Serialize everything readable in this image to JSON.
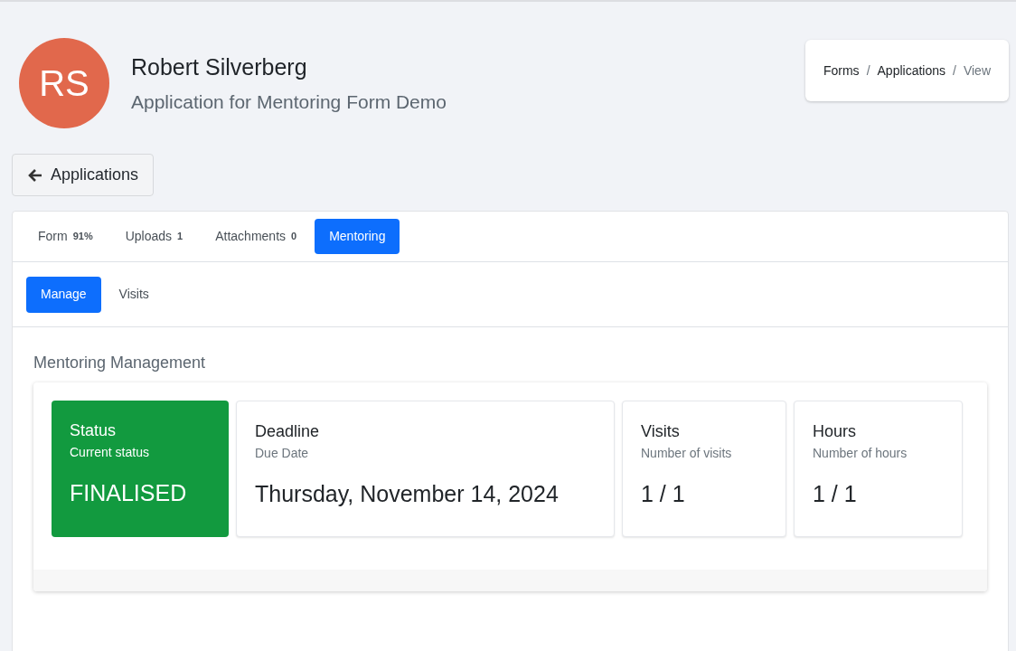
{
  "header": {
    "initials": "RS",
    "name": "Robert Silverberg",
    "subtitle": "Application for Mentoring Form Demo"
  },
  "breadcrumb": [
    {
      "label": "Forms",
      "current": false
    },
    {
      "separator_before": "/",
      "label": "Applications",
      "current": false
    },
    {
      "separator_before": "/",
      "label": "View",
      "current": true
    }
  ],
  "back_button": {
    "label": "Applications"
  },
  "tabs": [
    {
      "label": "Form",
      "badge": "91%",
      "selected": false
    },
    {
      "label": "Uploads",
      "badge": "1",
      "selected": false
    },
    {
      "label": "Attachments",
      "badge": "0",
      "selected": false
    },
    {
      "label": "Mentoring",
      "selected": true
    }
  ],
  "subtabs": [
    {
      "label": "Manage",
      "selected": true
    },
    {
      "label": "Visits",
      "selected": false
    }
  ],
  "section_title": "Mentoring Management",
  "cards": [
    {
      "kind": "status",
      "title": "Status",
      "subtitle": "Current status",
      "value": "FINALISED"
    },
    {
      "kind": "info",
      "title": "Deadline",
      "subtitle": "Due Date",
      "value": "Thursday, November 14, 2024"
    },
    {
      "kind": "info",
      "title": "Visits",
      "subtitle": "Number of visits",
      "value": "1 / 1"
    },
    {
      "kind": "info",
      "title": "Hours",
      "subtitle": "Number of hours",
      "value": "1 / 1"
    }
  ]
}
